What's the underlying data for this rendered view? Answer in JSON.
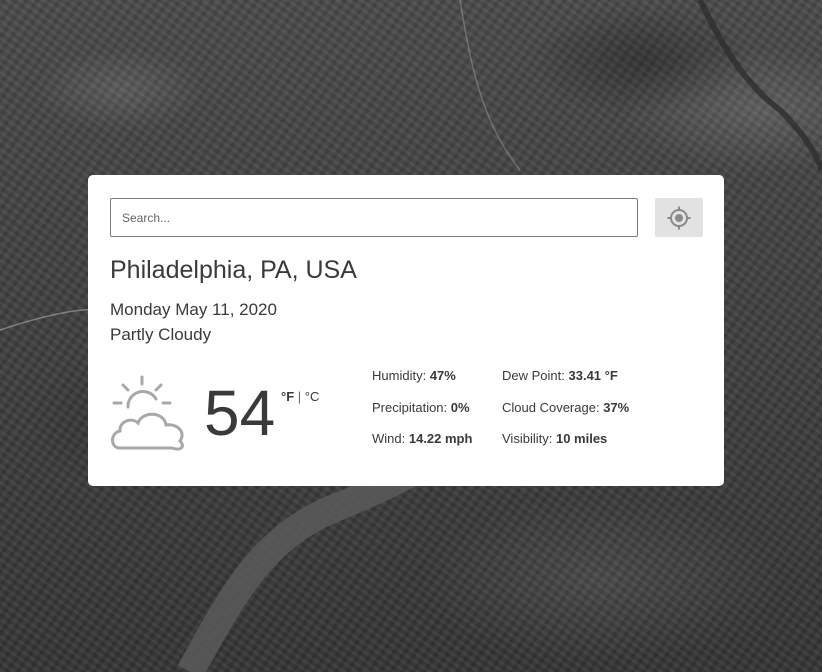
{
  "search": {
    "placeholder": "Search..."
  },
  "location": {
    "city": "Philadelphia, PA, USA"
  },
  "forecast": {
    "date": "Monday May 11, 2020",
    "condition": "Partly Cloudy",
    "icon": "partly-cloudy-icon",
    "temperature": "54",
    "unit_f": "°F",
    "unit_sep": "|",
    "unit_c": "°C"
  },
  "stats": {
    "humidity": {
      "label": "Humidity:",
      "value": "47%"
    },
    "precipitation": {
      "label": "Precipitation:",
      "value": "0%"
    },
    "wind": {
      "label": "Wind:",
      "value": "14.22 mph"
    },
    "dew_point": {
      "label": "Dew Point:",
      "value": "33.41 °F"
    },
    "cloud_coverage": {
      "label": "Cloud Coverage:",
      "value": "37%"
    },
    "visibility": {
      "label": "Visibility:",
      "value": "10 miles"
    }
  },
  "colors": {
    "card": "#ffffff",
    "text": "#3a3a3a",
    "locate_button": "#e2e2e2",
    "icon": "#a8a8a8"
  }
}
